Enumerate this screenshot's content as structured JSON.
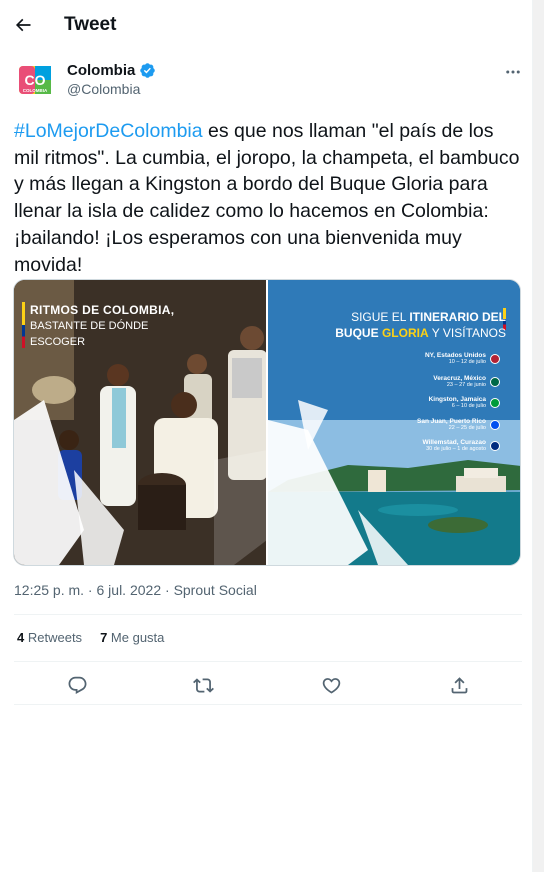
{
  "header": {
    "title": "Tweet",
    "back_icon": "arrow-left-icon"
  },
  "author": {
    "name": "Colombia",
    "handle": "@Colombia",
    "avatar_text": "CO",
    "avatar_subtext": "COLOMBIA",
    "verified": true
  },
  "tweet": {
    "hashtag": "#LoMejorDeColombia",
    "body": " es que nos llaman \"el país de los mil ritmos\". La cumbia, el joropo, la champeta, el bambuco y más llegan a Kingston a bordo del Buque Gloria para llenar la isla de calidez como lo hacemos en Colombia: ¡bailando! ¡Los esperamos con una bienvenida muy movida!"
  },
  "media": {
    "left": {
      "title_line1": "RITMOS DE COLOMBIA,",
      "title_line2": "BASTANTE DE DÓNDE",
      "title_line3": "ESCOGER"
    },
    "right": {
      "heading_a": "SIGUE EL",
      "heading_b": "ITINERARIO DEL",
      "heading_c": "BUQUE",
      "heading_d": "GLORIA",
      "heading_e": "Y VISÍTANOS",
      "stops": [
        {
          "city": "NY, Estados Unidos",
          "dates": "10 – 12 de julio",
          "flag_color": "#b22234"
        },
        {
          "city": "Veracruz, México",
          "dates": "23 – 27 de junio",
          "flag_color": "#006847"
        },
        {
          "city": "Kingston, Jamaica",
          "dates": "6 – 10 de julio",
          "flag_color": "#009b3a"
        },
        {
          "city": "San Juan, Puerto Rico",
          "dates": "22 – 25 de julio",
          "flag_color": "#0050f0"
        },
        {
          "city": "Willemstad, Curazao",
          "dates": "30 de julio – 1 de agosto",
          "flag_color": "#002b7f"
        }
      ]
    }
  },
  "meta": {
    "time": "12:25 p. m.",
    "separator": " · ",
    "date": "6 jul. 2022",
    "source": "Sprout Social"
  },
  "stats": {
    "retweets_count": "4",
    "retweets_label": "Retweets",
    "likes_count": "7",
    "likes_label": "Me gusta"
  },
  "actions": [
    "reply-icon",
    "retweet-icon",
    "like-icon",
    "share-icon"
  ],
  "colors": {
    "accent": "#1d9bf0",
    "text": "#0f1419",
    "muted": "#536471",
    "divider": "#eff3f4"
  }
}
